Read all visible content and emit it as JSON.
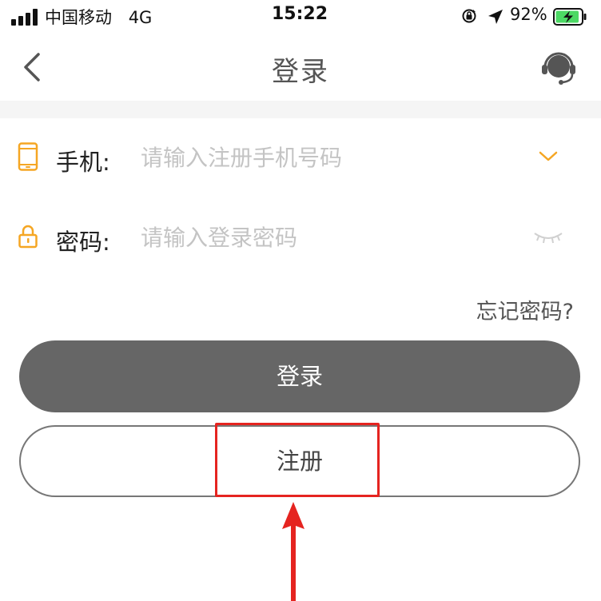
{
  "status_bar": {
    "carrier": "中国移动",
    "network": "4G",
    "time": "15:22",
    "battery_percent": "92%",
    "battery_level": 0.92,
    "battery_color": "#4cd964"
  },
  "nav": {
    "title": "登录",
    "back_icon": "chevron-left-icon",
    "support_icon": "headset-icon"
  },
  "form": {
    "phone": {
      "label": "手机:",
      "placeholder": "请输入注册手机号码",
      "value": "",
      "icon": "phone-icon",
      "action_icon": "chevron-down-icon"
    },
    "password": {
      "label": "密码:",
      "placeholder": "请输入登录密码",
      "value": "",
      "icon": "lock-icon",
      "action_icon": "eye-closed-icon"
    },
    "forgot_label": "忘记密码?"
  },
  "buttons": {
    "login_label": "登录",
    "register_label": "注册"
  },
  "colors": {
    "accent": "#f5a623",
    "login_button": "#666666",
    "annotation": "#e52420"
  }
}
